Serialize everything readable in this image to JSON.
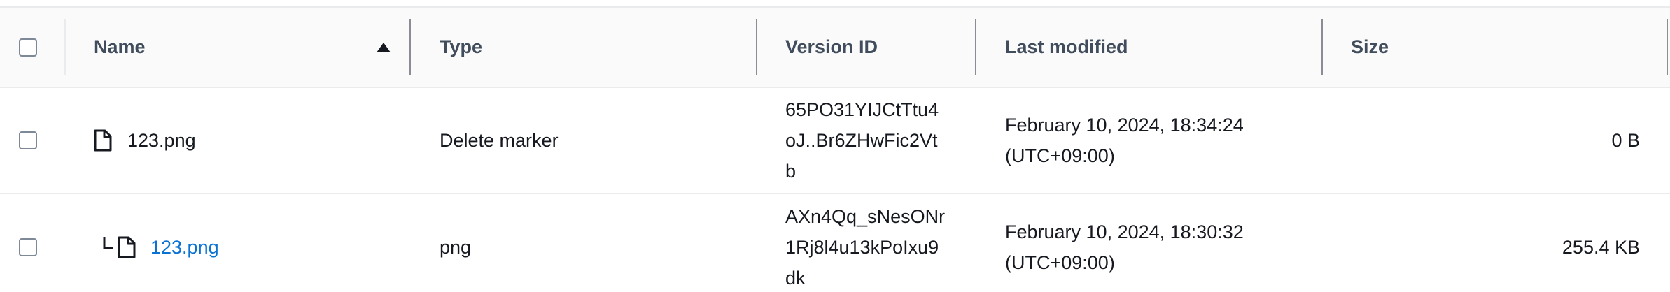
{
  "columns": {
    "name": "Name",
    "type": "Type",
    "version_id": "Version ID",
    "last_modified": "Last modified",
    "size": "Size"
  },
  "icons": {
    "select_all": "checkbox-icon",
    "sort": "sort-ascending-icon",
    "file": "file-icon",
    "nested": "nested-version-icon"
  },
  "rows": [
    {
      "name": "123.png",
      "type": "Delete marker",
      "version_id": "65PO31YIJCtTtu4\noJ..Br6ZHwFic2Vt\nb",
      "last_modified": "February 10, 2024, 18:34:24\n(UTC+09:00)",
      "size": "0 B",
      "is_link": false
    },
    {
      "name": "123.png",
      "type": "png",
      "version_id": "AXn4Qq_sNesONr\n1Rj8l4u13kPoIxu9\ndk",
      "last_modified": "February 10, 2024, 18:30:32\n(UTC+09:00)",
      "size": "255.4 KB",
      "is_link": true
    }
  ],
  "colors": {
    "link": "#0972d3",
    "header_bg": "#fafafa",
    "header_text": "#414d5c",
    "border": "#e9ebed"
  }
}
